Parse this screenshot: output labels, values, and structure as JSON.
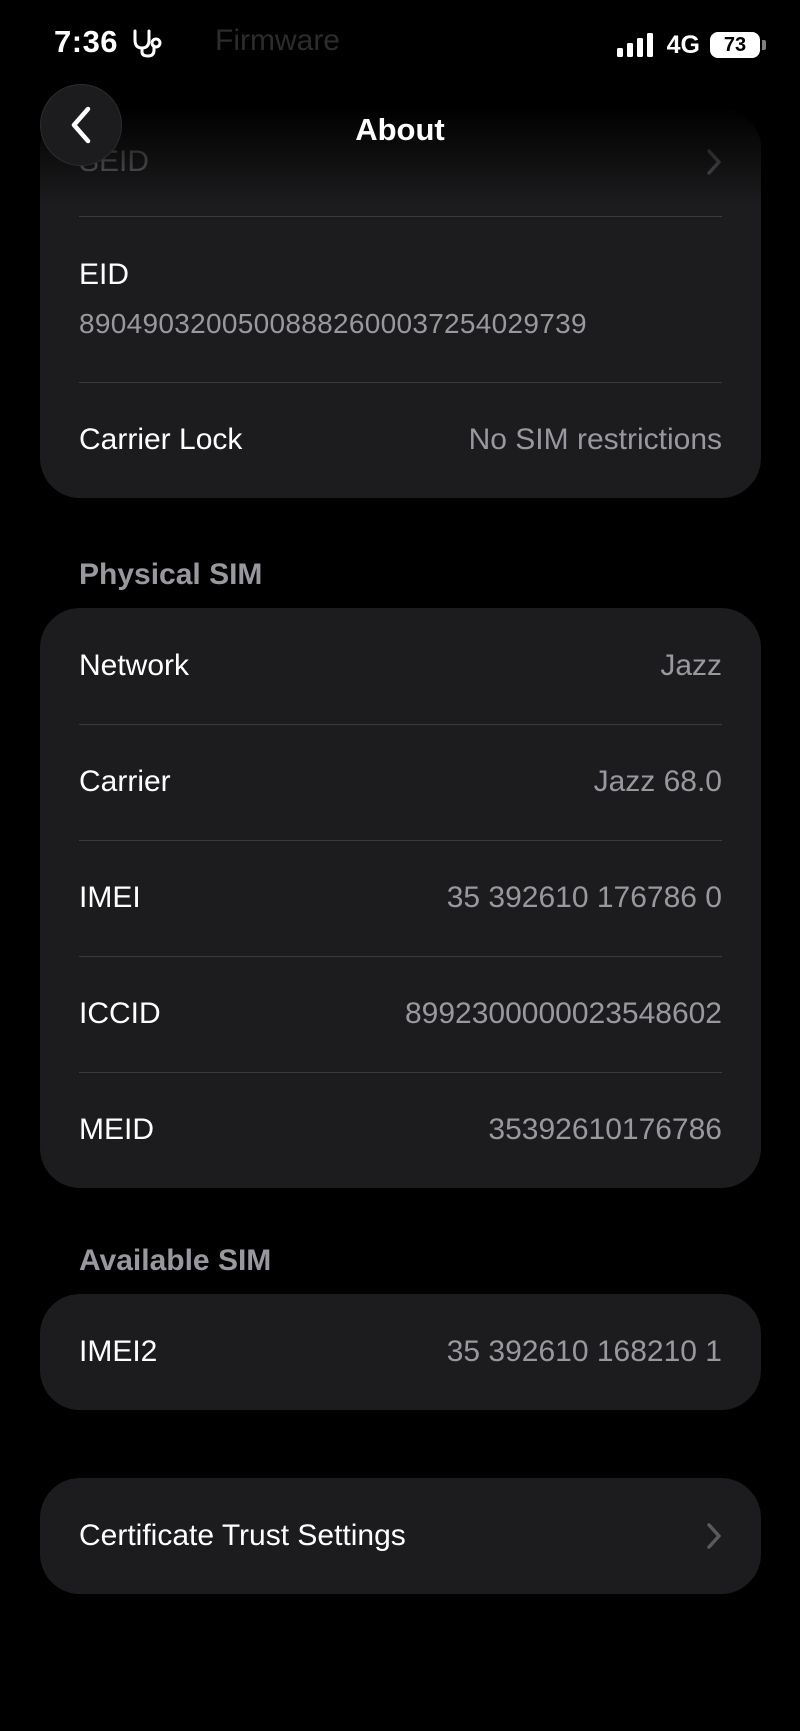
{
  "status_bar": {
    "time": "7:36",
    "network_type": "4G",
    "battery": "73",
    "health_icon": "stethoscope-icon",
    "ghost_title": "Firmware"
  },
  "nav": {
    "title": "About",
    "back_icon": "chevron-left-icon"
  },
  "device_group": {
    "seid_label": "SEID",
    "eid_label": "EID",
    "eid_value": "89049032005008882600037254029739",
    "carrier_lock_label": "Carrier Lock",
    "carrier_lock_value": "No SIM restrictions"
  },
  "physical_sim": {
    "header": "Physical SIM",
    "rows": [
      {
        "label": "Network",
        "value": "Jazz"
      },
      {
        "label": "Carrier",
        "value": "Jazz 68.0"
      },
      {
        "label": "IMEI",
        "value": "35 392610 176786 0"
      },
      {
        "label": "ICCID",
        "value": "8992300000023548602"
      },
      {
        "label": "MEID",
        "value": "35392610176786"
      }
    ]
  },
  "available_sim": {
    "header": "Available SIM",
    "rows": [
      {
        "label": "IMEI2",
        "value": "35 392610 168210 1"
      }
    ]
  },
  "certificate": {
    "label": "Certificate Trust Settings"
  },
  "colors": {
    "background": "#000000",
    "cell": "#1c1c1e",
    "separator": "#3a3a3c",
    "secondary_text": "#98989e"
  }
}
